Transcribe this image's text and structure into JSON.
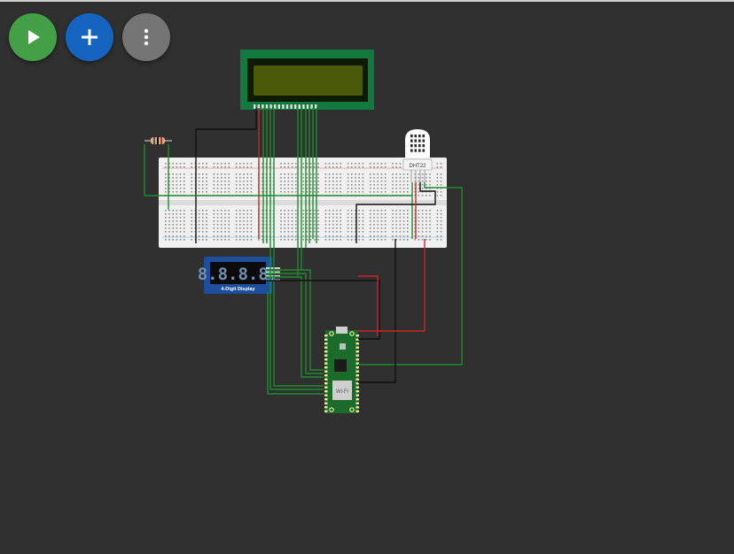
{
  "toolbar": {
    "play_color": "#43a047",
    "add_color": "#1565c0",
    "more_color": "#757575"
  },
  "canvas": {
    "background": "#303030",
    "components": {
      "lcd": {
        "bezel_color": "#127a3e",
        "screen_color": "#4a5a08"
      },
      "resistor": {},
      "dht22": {
        "label": "DHT22"
      },
      "breadboard": {
        "color": "#f0f0f0"
      },
      "seven_segment": {
        "digits": "8.8.8.8.",
        "label": "4-Digit Display",
        "color": "#1e4f9c"
      },
      "pico": {
        "label": "Wi-Fi",
        "color": "#1b6b2a"
      }
    },
    "wire_colors": {
      "black": "#111111",
      "red": "#c62828",
      "green": "#1f8a2e"
    }
  }
}
